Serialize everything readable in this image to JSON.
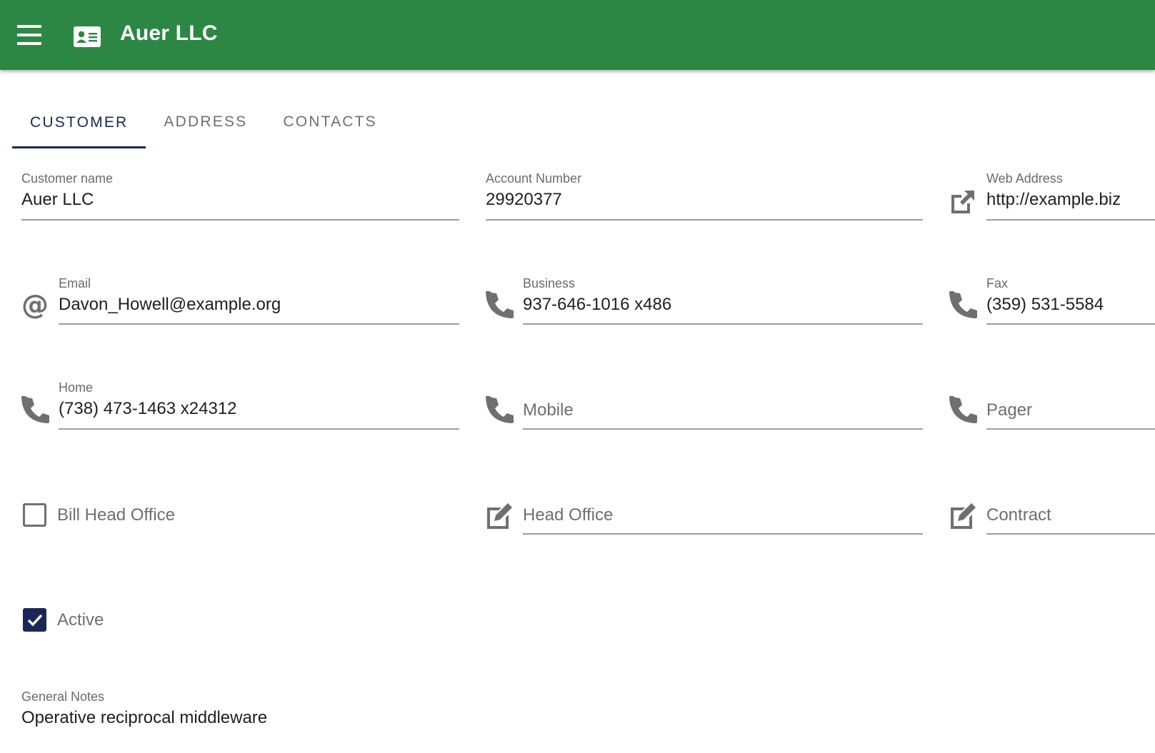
{
  "appbar": {
    "title": "Auer LLC",
    "color": "#2d8744",
    "menu_icon": "hamburger-menu-icon",
    "app_icon": "contact-card-icon"
  },
  "tabs": [
    {
      "label": "CUSTOMER",
      "active": true
    },
    {
      "label": "ADDRESS",
      "active": false
    },
    {
      "label": "CONTACTS",
      "active": false
    }
  ],
  "fields": {
    "customer_name": {
      "label": "Customer name",
      "value": "Auer LLC"
    },
    "account_number": {
      "label": "Account Number",
      "value": "29920377"
    },
    "web_address": {
      "label": "Web Address",
      "value": "http://example.biz",
      "icon": "open-external-icon"
    },
    "email": {
      "label": "Email",
      "value": "Davon_Howell@example.org",
      "icon": "at-sign-icon"
    },
    "business": {
      "label": "Business",
      "value": "937-646-1016 x486",
      "icon": "phone-icon"
    },
    "fax": {
      "label": "Fax",
      "value": "(359) 531-5584",
      "icon": "phone-icon"
    },
    "home": {
      "label": "Home",
      "value": "(738) 473-1463 x24312",
      "icon": "phone-icon"
    },
    "mobile": {
      "placeholder": "Mobile",
      "icon": "phone-icon"
    },
    "pager": {
      "placeholder": "Pager",
      "icon": "phone-icon"
    },
    "head_office": {
      "placeholder": "Head Office",
      "icon": "edit-icon"
    },
    "contract": {
      "placeholder": "Contract",
      "icon": "edit-icon"
    },
    "general_notes": {
      "label": "General Notes",
      "value": "Operative reciprocal middleware"
    }
  },
  "checkboxes": {
    "bill_head_office": {
      "label": "Bill Head Office",
      "checked": false
    },
    "active": {
      "label": "Active",
      "checked": true
    }
  },
  "colors": {
    "accent": "#1b2756",
    "icon_gray": "#6f6f6f",
    "underline": "#9e9e9e"
  }
}
